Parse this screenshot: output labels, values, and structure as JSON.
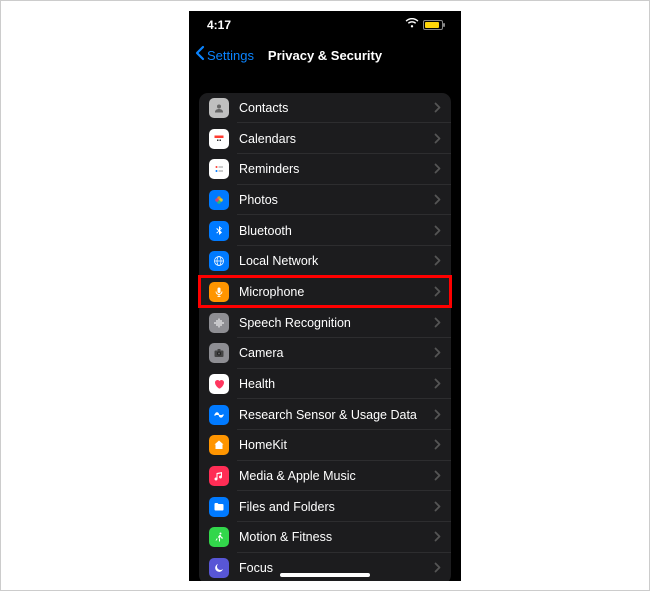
{
  "status": {
    "time": "4:17"
  },
  "nav": {
    "back_label": "Settings",
    "title": "Privacy & Security"
  },
  "colors": {
    "contacts": "#bfbfbf",
    "calendars": "#ffffff",
    "reminders": "#ffffff",
    "photos": "#007aff",
    "bluetooth": "#007aff",
    "localnetwork": "#007aff",
    "microphone": "#ff9500",
    "speech": "#8e8e93",
    "camera": "#8e8e93",
    "health": "#ffffff",
    "research": "#007aff",
    "homekit": "#ff9500",
    "media": "#ff2d55",
    "files": "#007aff",
    "motion": "#32d74b",
    "focus": "#5856d6"
  },
  "rows": [
    {
      "id": "contacts",
      "label": "Contacts",
      "icon": "contacts-icon",
      "highlight": false
    },
    {
      "id": "calendars",
      "label": "Calendars",
      "icon": "calendar-icon",
      "highlight": false
    },
    {
      "id": "reminders",
      "label": "Reminders",
      "icon": "reminders-icon",
      "highlight": false
    },
    {
      "id": "photos",
      "label": "Photos",
      "icon": "photos-icon",
      "highlight": false
    },
    {
      "id": "bluetooth",
      "label": "Bluetooth",
      "icon": "bluetooth-icon",
      "highlight": false
    },
    {
      "id": "localnetwork",
      "label": "Local Network",
      "icon": "network-icon",
      "highlight": false
    },
    {
      "id": "microphone",
      "label": "Microphone",
      "icon": "microphone-icon",
      "highlight": true
    },
    {
      "id": "speech",
      "label": "Speech Recognition",
      "icon": "waveform-icon",
      "highlight": false
    },
    {
      "id": "camera",
      "label": "Camera",
      "icon": "camera-icon",
      "highlight": false
    },
    {
      "id": "health",
      "label": "Health",
      "icon": "heart-icon",
      "highlight": false
    },
    {
      "id": "research",
      "label": "Research Sensor & Usage Data",
      "icon": "research-icon",
      "highlight": false
    },
    {
      "id": "homekit",
      "label": "HomeKit",
      "icon": "home-icon",
      "highlight": false
    },
    {
      "id": "media",
      "label": "Media & Apple Music",
      "icon": "music-icon",
      "highlight": false
    },
    {
      "id": "files",
      "label": "Files and Folders",
      "icon": "folder-icon",
      "highlight": false
    },
    {
      "id": "motion",
      "label": "Motion & Fitness",
      "icon": "motion-icon",
      "highlight": false
    },
    {
      "id": "focus",
      "label": "Focus",
      "icon": "moon-icon",
      "highlight": false
    }
  ]
}
